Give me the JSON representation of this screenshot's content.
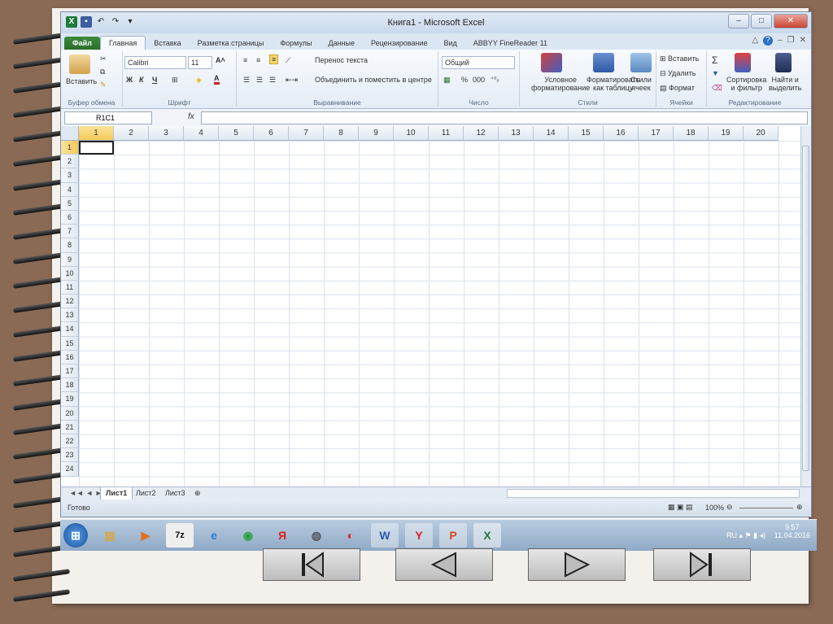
{
  "window": {
    "title": "Книга1 - Microsoft Excel"
  },
  "tabs": [
    "Файл",
    "Главная",
    "Вставка",
    "Разметка страницы",
    "Формулы",
    "Данные",
    "Рецензирование",
    "Вид",
    "ABBYY FineReader 11"
  ],
  "ribbon": {
    "clipboard": {
      "paste": "Вставить",
      "label": "Буфер обмена"
    },
    "font": {
      "name": "Calibri",
      "size": "11",
      "label": "Шрифт",
      "bold": "Ж",
      "italic": "К",
      "underline": "Ч"
    },
    "alignment": {
      "wrap": "Перенос текста",
      "merge": "Объединить и поместить в центре",
      "label": "Выравнивание"
    },
    "number": {
      "format": "Общий",
      "percent": "%",
      "thousands": "000",
      "label": "Число"
    },
    "styles": {
      "conditional": [
        "Условное",
        "форматирование"
      ],
      "as_table": [
        "Форматировать",
        "как таблицу"
      ],
      "cell_styles": [
        "Стили",
        "ячеек"
      ],
      "label": "Стили"
    },
    "cells": {
      "insert": "Вставить",
      "delete": "Удалить",
      "format": "Формат",
      "label": "Ячейки"
    },
    "editing": {
      "sort": [
        "Сортировка",
        "и фильтр"
      ],
      "find": [
        "Найти и",
        "выделить"
      ],
      "label": "Редактирование"
    }
  },
  "formula_bar": {
    "name_box": "R1C1",
    "fx": "fx"
  },
  "columns": [
    "1",
    "2",
    "3",
    "4",
    "5",
    "6",
    "7",
    "8",
    "9",
    "10",
    "11",
    "12",
    "13",
    "14",
    "15",
    "16",
    "17",
    "18",
    "19",
    "20"
  ],
  "rows": [
    "1",
    "2",
    "3",
    "4",
    "5",
    "6",
    "7",
    "8",
    "9",
    "10",
    "11",
    "12",
    "13",
    "14",
    "15",
    "16",
    "17",
    "18",
    "19",
    "20",
    "21",
    "22",
    "23",
    "24"
  ],
  "sheets": [
    "Лист1",
    "Лист2",
    "Лист3"
  ],
  "status": {
    "ready": "Готово",
    "zoom": "100%"
  },
  "tray": {
    "lang": "RU",
    "time": "9:57",
    "date": "11.04.2016"
  },
  "colors": {
    "file_tab": "#2a6e2a",
    "selected_header": "#f6c957",
    "grid_line": "#dbe3ee"
  }
}
